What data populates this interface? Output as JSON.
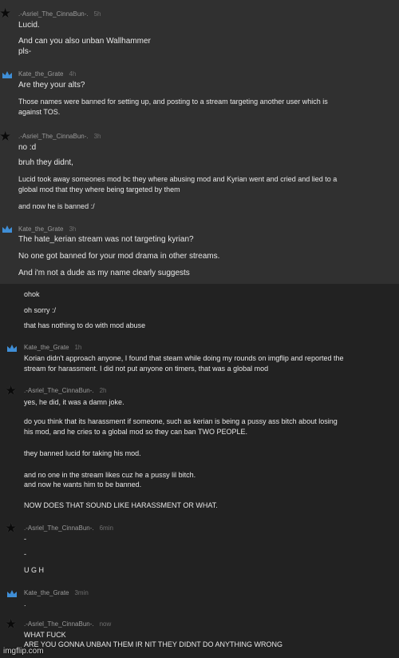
{
  "messages": [
    {
      "user": ".-Asriel_The_CinnaBun-.",
      "time": "5h",
      "icon": "star-icon",
      "lines": [
        "Lucid.",
        "And can you also unban Wallhammer",
        "pls-"
      ]
    },
    {
      "user": "Kate_the_Grate",
      "time": "4h",
      "icon": "crown-icon",
      "lines": [
        "Are they your alts?",
        "Those names were banned for setting up, and posting to a stream targeting another user which is",
        "against TOS."
      ]
    },
    {
      "user": ".-Asriel_The_CinnaBun-.",
      "time": "3h",
      "icon": "star-icon",
      "lines": [
        "no :d",
        "bruh they didnt,",
        "Lucid took away someones mod bc they where abusing mod and Kyrian went and cried and lied to a",
        "global mod that they where being targeted by them",
        "and now he is banned :/"
      ]
    },
    {
      "user": "Kate_the_Grate",
      "time": "3h",
      "icon": "crown-icon",
      "lines": [
        "The hate_kerian stream was not targeting kyrian?",
        "No one got banned for your mod drama in other streams.",
        "And i'm not a dude as my name clearly suggests"
      ]
    },
    {
      "user": "",
      "time": "",
      "icon": "",
      "lines": [
        "ohok",
        "oh sorry :/",
        "that has nothing to do with mod abuse"
      ]
    },
    {
      "user": "Kate_the_Grate",
      "time": "1h",
      "icon": "crown-icon",
      "lines": [
        "Korian didn't approach anyone, I found that steam while doing my rounds on imgflip and reported the",
        "stream for harassment. I did not put anyone on timers, that was a global mod"
      ]
    },
    {
      "user": ".-Asriel_The_CinnaBun-.",
      "time": "2h",
      "icon": "star-icon",
      "lines": [
        "yes, he did, it was a damn joke.",
        "do you think that its harassment if someone, such as kerian is being a pussy ass bitch about losing",
        "his mod, and he cries to a global mod so they can ban TWO PEOPLE.",
        "they banned lucid for taking his mod.",
        "and no one in the stream likes cuz he a pussy lil bitch.",
        "and now he wants him to be banned.",
        "NOW DOES THAT SOUND LIKE HARASSMENT OR WHAT."
      ]
    },
    {
      "user": ".-Asriel_The_CinnaBun-.",
      "time": "6min",
      "icon": "star-icon",
      "lines": [
        "-",
        "-",
        "U G H"
      ]
    },
    {
      "user": "Kate_the_Grate",
      "time": "3min",
      "icon": "crown-icon",
      "lines": [
        "."
      ]
    },
    {
      "user": ".-Asriel_The_CinnaBun-.",
      "time": "now",
      "icon": "star-icon",
      "lines": [
        "WHAT FUCK",
        "ARE YOU GONNA UNBAN THEM IR NIT THEY DIDNT DO ANYTHING WRONG"
      ]
    }
  ],
  "watermark": "imgflip.com"
}
